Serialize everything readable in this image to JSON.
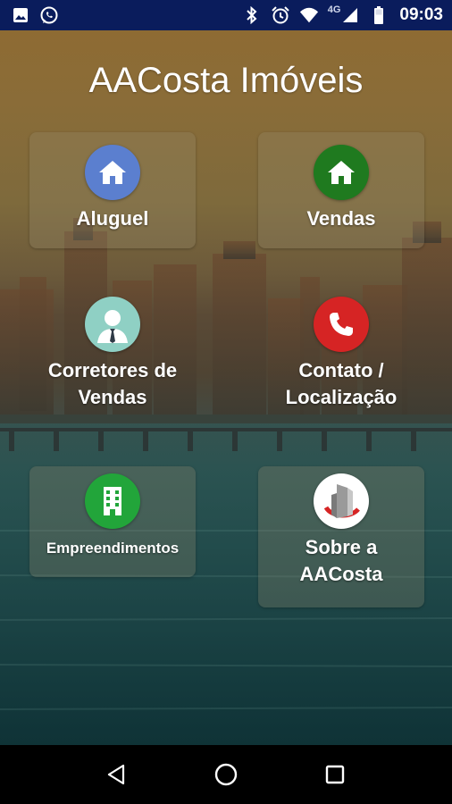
{
  "status_bar": {
    "time": "09:03",
    "network": "4G",
    "left_icons": [
      "image-icon",
      "whatsapp-icon"
    ],
    "right_icons": [
      "bluetooth-icon",
      "alarm-icon",
      "wifi-icon",
      "signal-icon",
      "battery-icon"
    ],
    "background": "#0a1c5c"
  },
  "app": {
    "title": "AACosta Imóveis"
  },
  "tiles": [
    {
      "label": "Aluguel",
      "icon": "house-icon",
      "color": "#5b7fcf"
    },
    {
      "label": "Vendas",
      "icon": "house-icon",
      "color": "#1f7a1f"
    },
    {
      "label": "Corretores de\nVendas",
      "icon": "broker-icon",
      "color": "#8fd0c4"
    },
    {
      "label": "Contato /\nLocalização",
      "icon": "phone-icon",
      "color": "#d62424"
    },
    {
      "label": "Empreendimentos",
      "icon": "building-icon",
      "color": "#22a53a"
    },
    {
      "label": "Sobre a\nAACosta",
      "icon": "company-logo-icon",
      "color": "#ffffff"
    }
  ],
  "nav_bar": {
    "buttons": [
      "back-icon",
      "home-icon",
      "recents-icon"
    ]
  }
}
